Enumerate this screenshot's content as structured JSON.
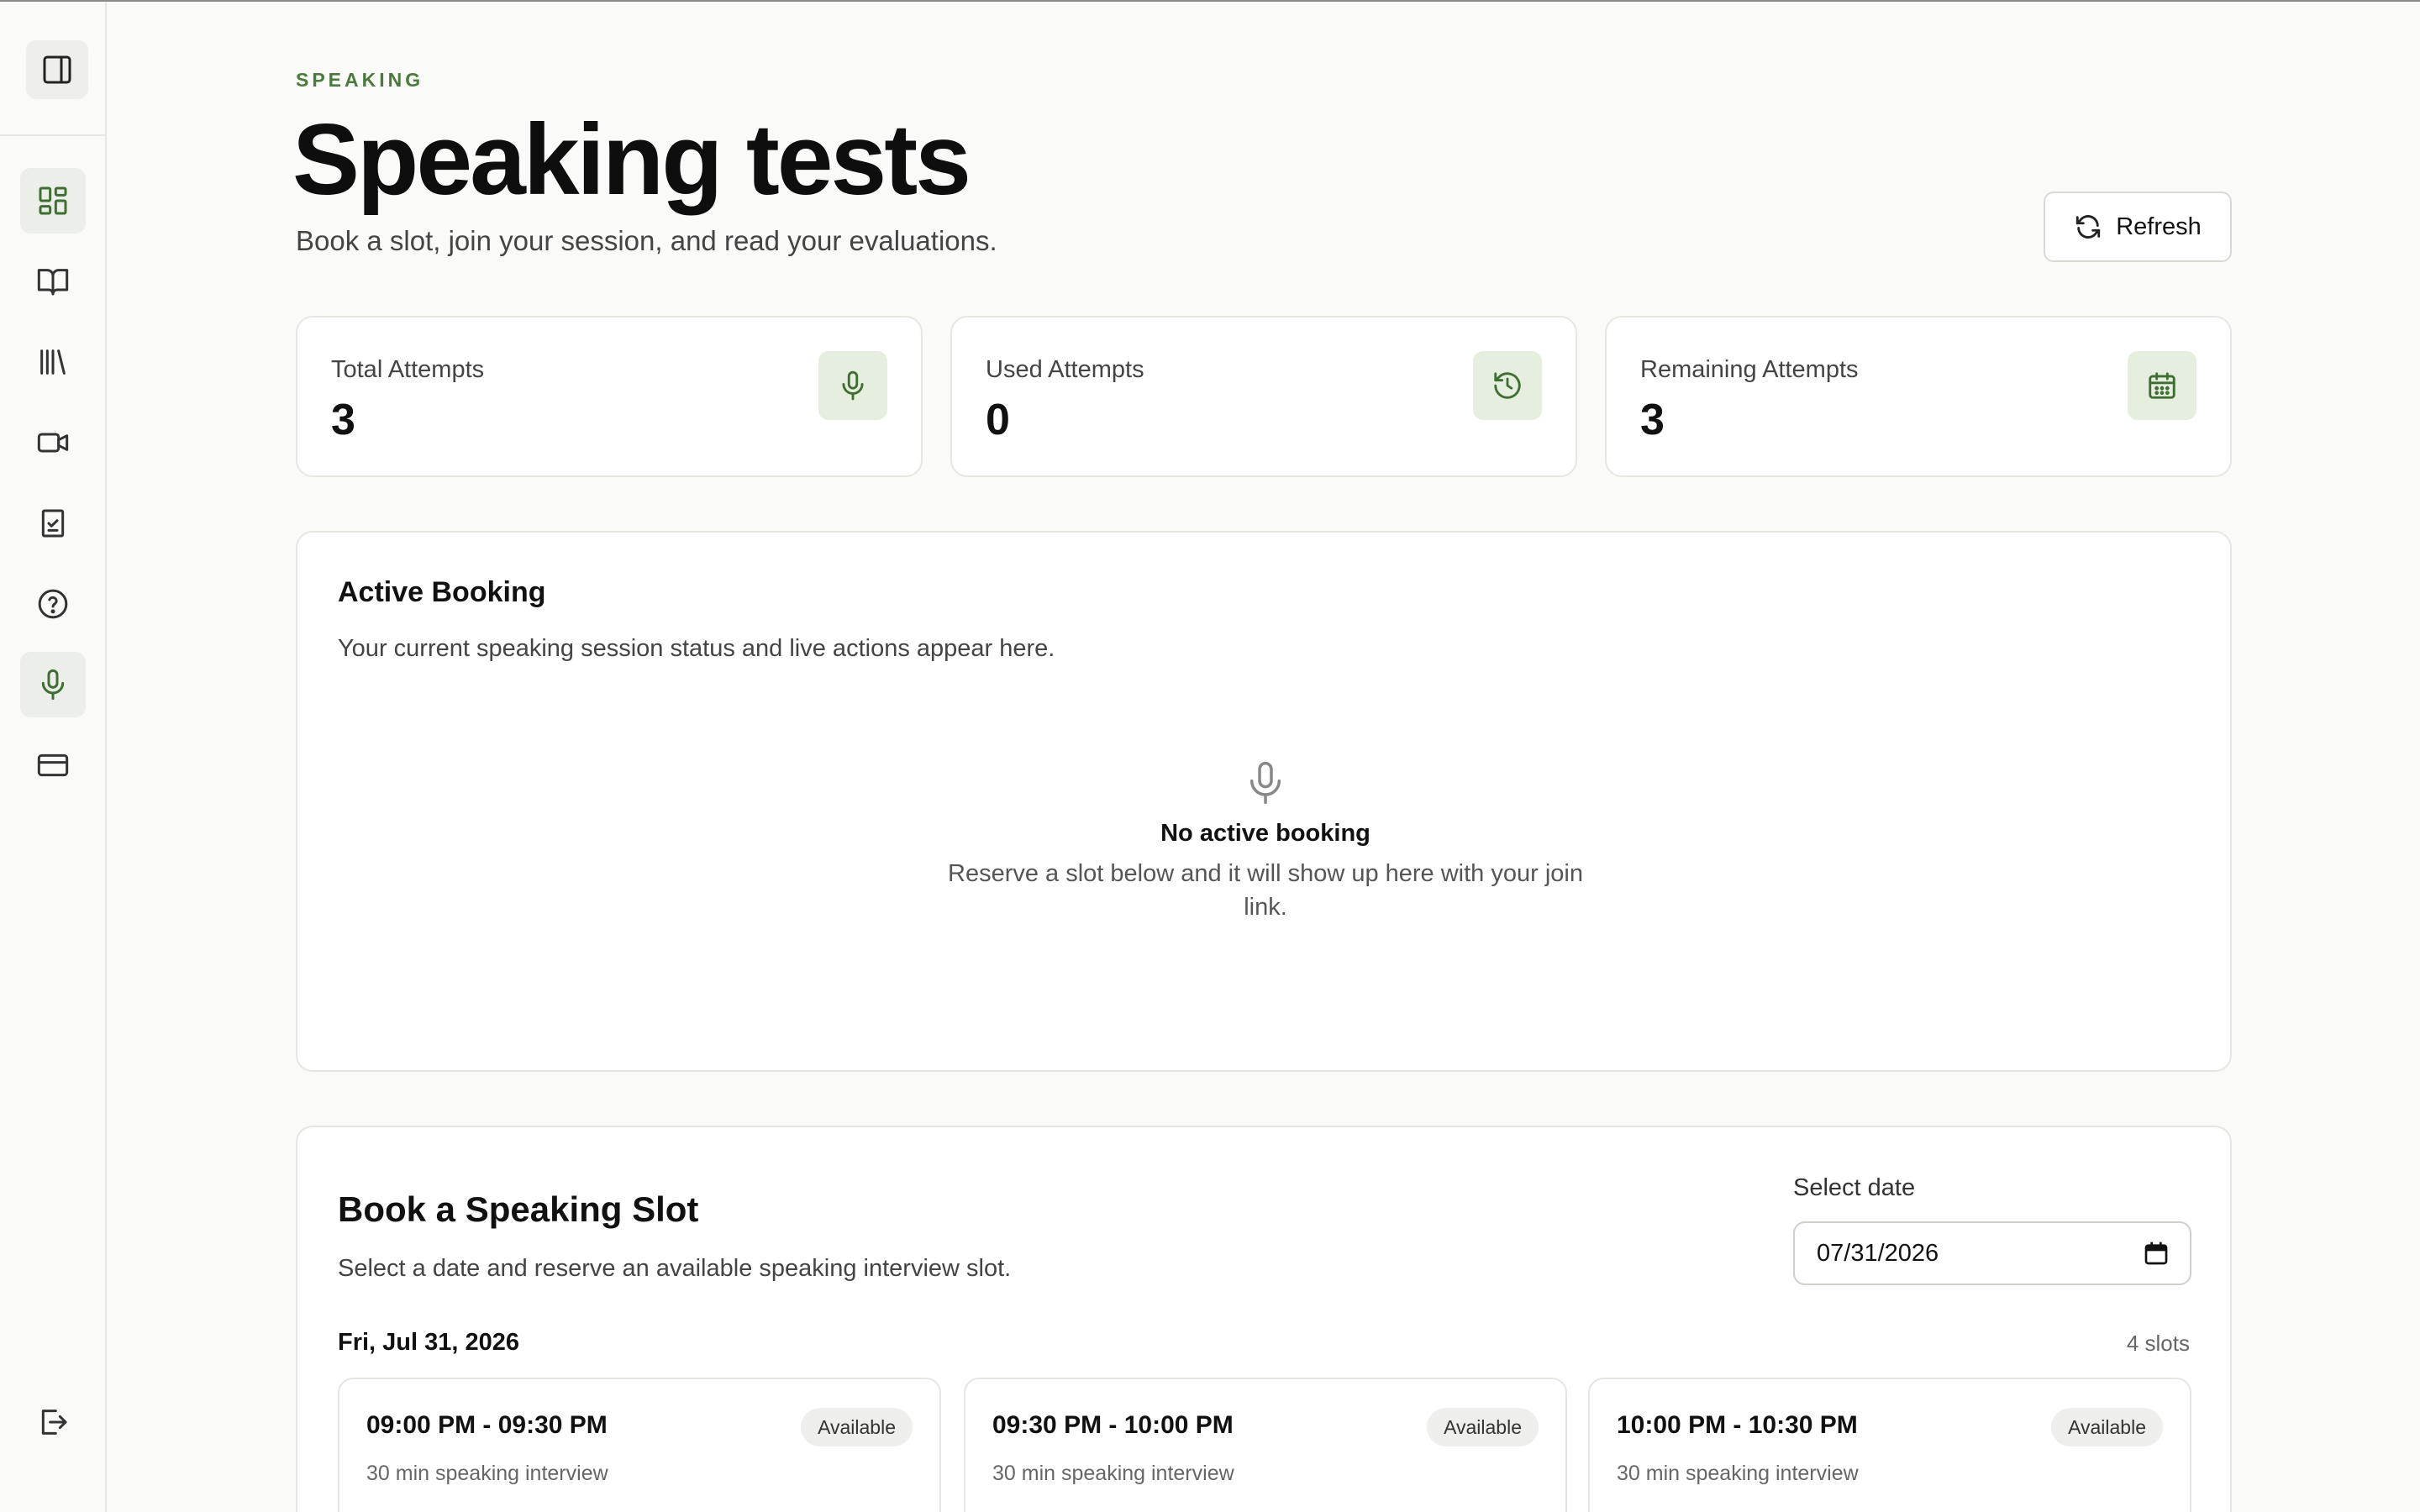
{
  "header": {
    "eyebrow": "SPEAKING",
    "title": "Speaking tests",
    "subtitle": "Book a slot, join your session, and read your evaluations.",
    "refresh_label": "Refresh"
  },
  "sidebar": {
    "toggle_icon": "sidebar-toggle-icon",
    "items": [
      {
        "icon": "dashboard-icon",
        "active": true
      },
      {
        "icon": "book-open-icon",
        "active": false
      },
      {
        "icon": "library-icon",
        "active": false
      },
      {
        "icon": "video-icon",
        "active": false
      },
      {
        "icon": "clipboard-check-icon",
        "active": false
      },
      {
        "icon": "help-circle-icon",
        "active": false
      },
      {
        "icon": "microphone-icon",
        "active": true
      },
      {
        "icon": "credit-card-icon",
        "active": false
      }
    ],
    "logout_icon": "logout-icon"
  },
  "stats": [
    {
      "label": "Total Attempts",
      "value": "3",
      "icon": "microphone-icon"
    },
    {
      "label": "Used Attempts",
      "value": "0",
      "icon": "history-icon"
    },
    {
      "label": "Remaining Attempts",
      "value": "3",
      "icon": "calendar-icon"
    }
  ],
  "active_booking": {
    "title": "Active Booking",
    "description": "Your current speaking session status and live actions appear here.",
    "empty_title": "No active booking",
    "empty_description": "Reserve a slot below and it will show up here with your join link."
  },
  "booking": {
    "title": "Book a Speaking Slot",
    "description": "Select a date and reserve an available speaking interview slot.",
    "date_label": "Select date",
    "date_value": "07/31/2026",
    "day_heading": "Fri, Jul 31, 2026",
    "slot_count": "4 slots",
    "slots": [
      {
        "time": "09:00 PM - 09:30 PM",
        "subtitle": "30 min speaking interview",
        "status": "Available"
      },
      {
        "time": "09:30 PM - 10:00 PM",
        "subtitle": "30 min speaking interview",
        "status": "Available"
      },
      {
        "time": "10:00 PM - 10:30 PM",
        "subtitle": "30 min speaking interview",
        "status": "Available"
      }
    ]
  },
  "colors": {
    "accent": "#4a7a3c",
    "icon_bg": "#e5eedf",
    "active_nav_bg": "#ecefe9"
  }
}
